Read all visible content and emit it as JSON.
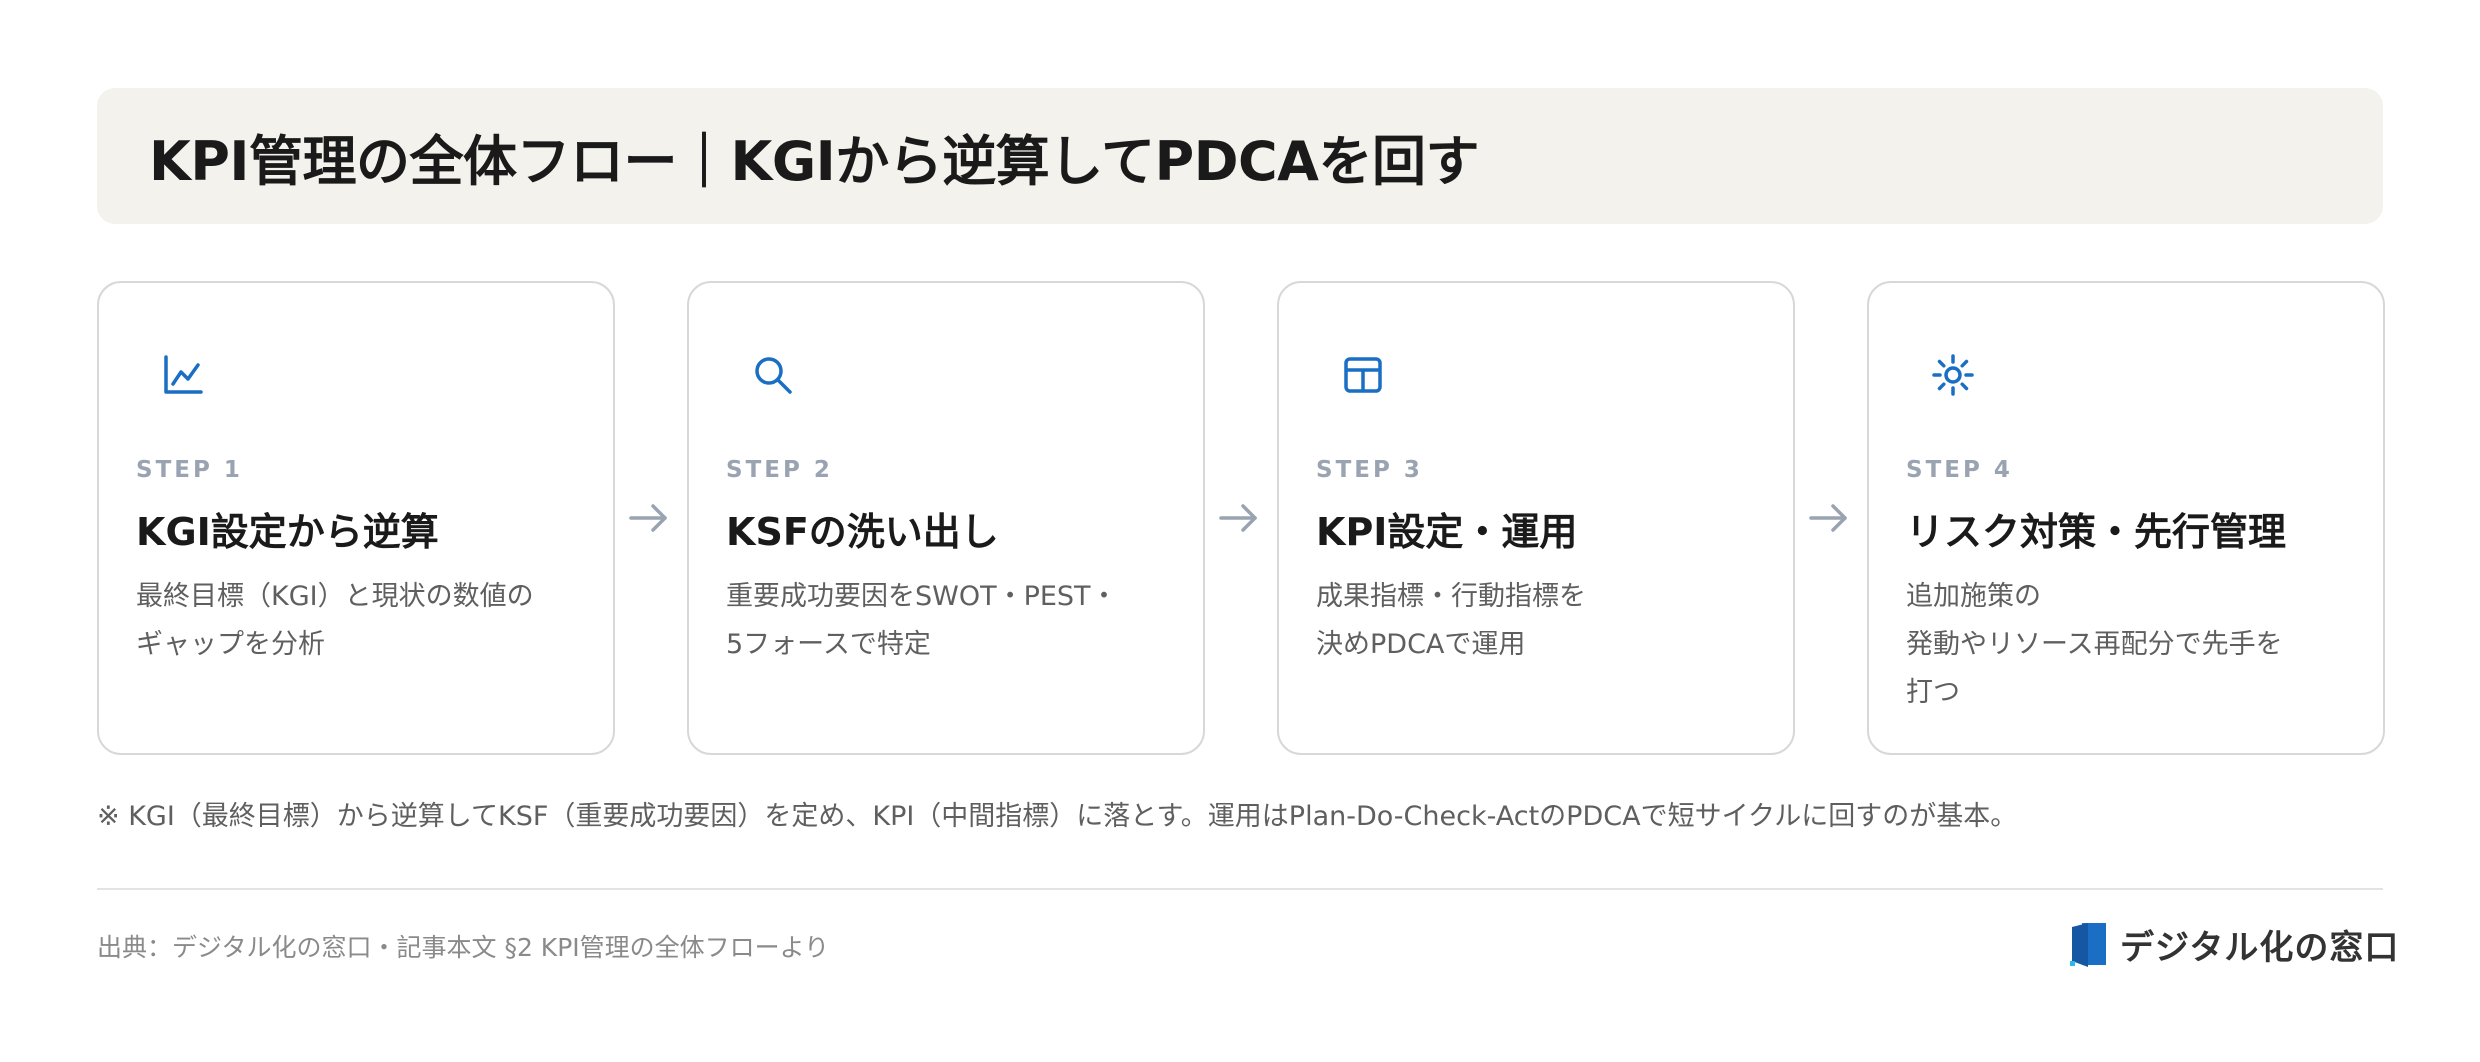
{
  "title": "KPI管理の全体フロー｜KGIから逆算してPDCAを回す",
  "colors": {
    "accent": "#1a6fc4",
    "step_label": "#9aa3b1",
    "banner_bg": "#f4f2ec",
    "arrow": "#9aa3b1"
  },
  "steps": [
    {
      "icon": "line-chart-icon",
      "step": "STEP 1",
      "heading": "KGI設定から逆算",
      "desc": [
        "最終目標（KGI）と現状の数値の",
        "ギャップを分析"
      ]
    },
    {
      "icon": "search-icon",
      "step": "STEP 2",
      "heading": "KSFの洗い出し",
      "desc": [
        "重要成功要因をSWOT・PEST・",
        "5フォースで特定"
      ]
    },
    {
      "icon": "table-icon",
      "step": "STEP 3",
      "heading": "KPI設定・運用",
      "desc": [
        "成果指標・行動指標を",
        "決めPDCAで運用"
      ]
    },
    {
      "icon": "sun-icon",
      "step": "STEP 4",
      "heading": "リスク対策・先行管理",
      "desc": [
        "追加施策の",
        "発動やリソース再配分で先手を",
        "打つ"
      ]
    }
  ],
  "footnote": "※ KGI（最終目標）から逆算してKSF（重要成功要因）を定め、KPI（中間指標）に落とす。運用はPlan-Do-Check-ActのPDCAで短サイクルに回すのが基本。",
  "source": "出典：デジタル化の窓口・記事本文 §2 KPI管理の全体フローより",
  "brand": "デジタル化の窓口"
}
